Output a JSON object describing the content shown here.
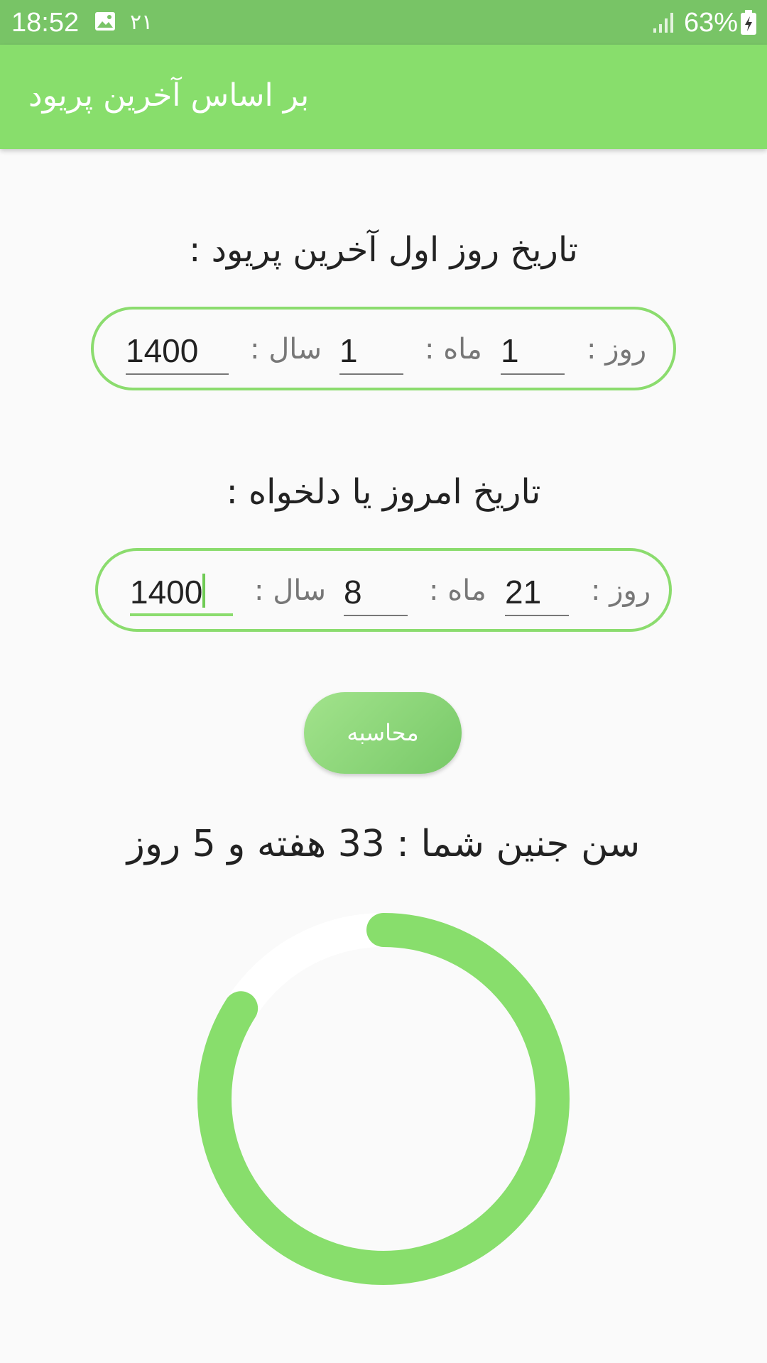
{
  "status_bar": {
    "time": "18:52",
    "persian_number": "۲۱",
    "battery": "63%",
    "icons": [
      "gallery-icon",
      "signal-icon",
      "battery-icon"
    ]
  },
  "app_bar": {
    "title": "بر اساس آخرین پریود"
  },
  "last_period": {
    "title": "تاریخ روز اول آخرین پریود :",
    "day_label": "روز :",
    "day_value": "1",
    "month_label": "ماه :",
    "month_value": "1",
    "year_label": "سال :",
    "year_value": "1400"
  },
  "today": {
    "title": "تاریخ امروز یا دلخواه :",
    "day_label": "روز :",
    "day_value": "21",
    "month_label": "ماه :",
    "month_value": "8",
    "year_label": "سال :",
    "year_value": "1400"
  },
  "calculate_button": "محاسبه",
  "result": "سن جنین شما : 33 هفته و 5 روز",
  "progress": {
    "fraction": 0.84,
    "color": "#88de6c",
    "track_color": "#ffffff"
  },
  "colors": {
    "status_bar": "#78c466",
    "app_bar": "#88de6c",
    "accent": "#8bdc6e"
  }
}
